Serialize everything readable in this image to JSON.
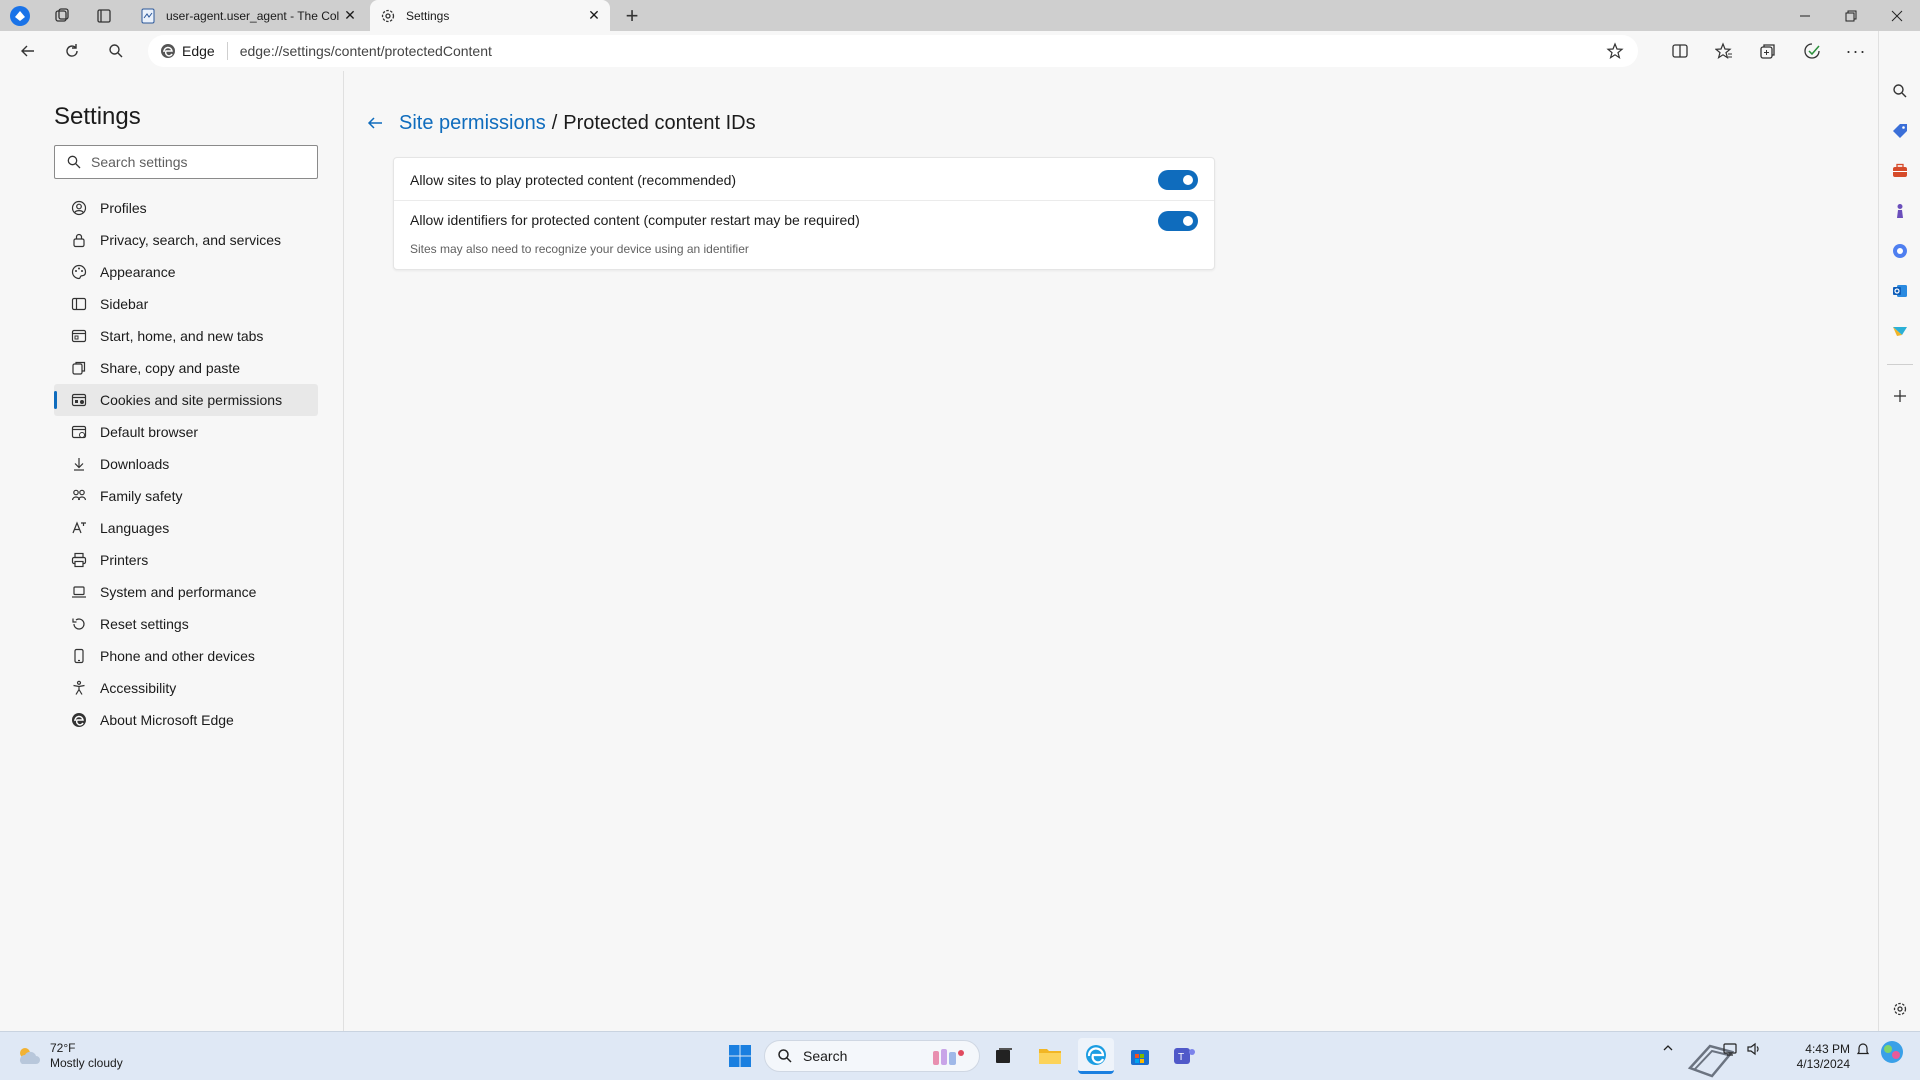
{
  "browser": {
    "tabs": [
      {
        "title": "user-agent.user_agent - The Coll",
        "favicon": "document-icon"
      },
      {
        "title": "Settings",
        "favicon": "gear-icon"
      }
    ],
    "new_tab_label": "+",
    "address": {
      "chip_label": "Edge",
      "url": "edge://settings/content/protectedContent"
    }
  },
  "settings": {
    "title": "Settings",
    "search_placeholder": "Search settings",
    "nav": [
      {
        "label": "Profiles",
        "icon": "profile-icon"
      },
      {
        "label": "Privacy, search, and services",
        "icon": "lock-icon"
      },
      {
        "label": "Appearance",
        "icon": "appearance-icon"
      },
      {
        "label": "Sidebar",
        "icon": "sidebar-icon"
      },
      {
        "label": "Start, home, and new tabs",
        "icon": "home-icon"
      },
      {
        "label": "Share, copy and paste",
        "icon": "share-icon"
      },
      {
        "label": "Cookies and site permissions",
        "icon": "cookies-icon",
        "selected": true
      },
      {
        "label": "Default browser",
        "icon": "browser-icon"
      },
      {
        "label": "Downloads",
        "icon": "download-icon"
      },
      {
        "label": "Family safety",
        "icon": "family-icon"
      },
      {
        "label": "Languages",
        "icon": "languages-icon"
      },
      {
        "label": "Printers",
        "icon": "printer-icon"
      },
      {
        "label": "System and performance",
        "icon": "laptop-icon"
      },
      {
        "label": "Reset settings",
        "icon": "reset-icon"
      },
      {
        "label": "Phone and other devices",
        "icon": "phone-icon"
      },
      {
        "label": "Accessibility",
        "icon": "accessibility-icon"
      },
      {
        "label": "About Microsoft Edge",
        "icon": "edge-logo-icon"
      }
    ]
  },
  "page": {
    "breadcrumb_parent": "Site permissions",
    "breadcrumb_separator": "/",
    "breadcrumb_current": "Protected content IDs",
    "options": [
      {
        "label": "Allow sites to play protected content (recommended)",
        "enabled": true
      },
      {
        "label": "Allow identifiers for protected content (computer restart may be required)",
        "sub": "Sites may also need to recognize your device using an identifier",
        "enabled": true
      }
    ]
  },
  "taskbar": {
    "weather_temp": "72°F",
    "weather_desc": "Mostly cloudy",
    "search_label": "Search",
    "clock_time": "4:43 PM",
    "clock_date": "4/13/2024"
  },
  "colors": {
    "accent": "#0f6cbd",
    "background": "#f7f7f7",
    "taskbar": "#dfe8f5"
  }
}
